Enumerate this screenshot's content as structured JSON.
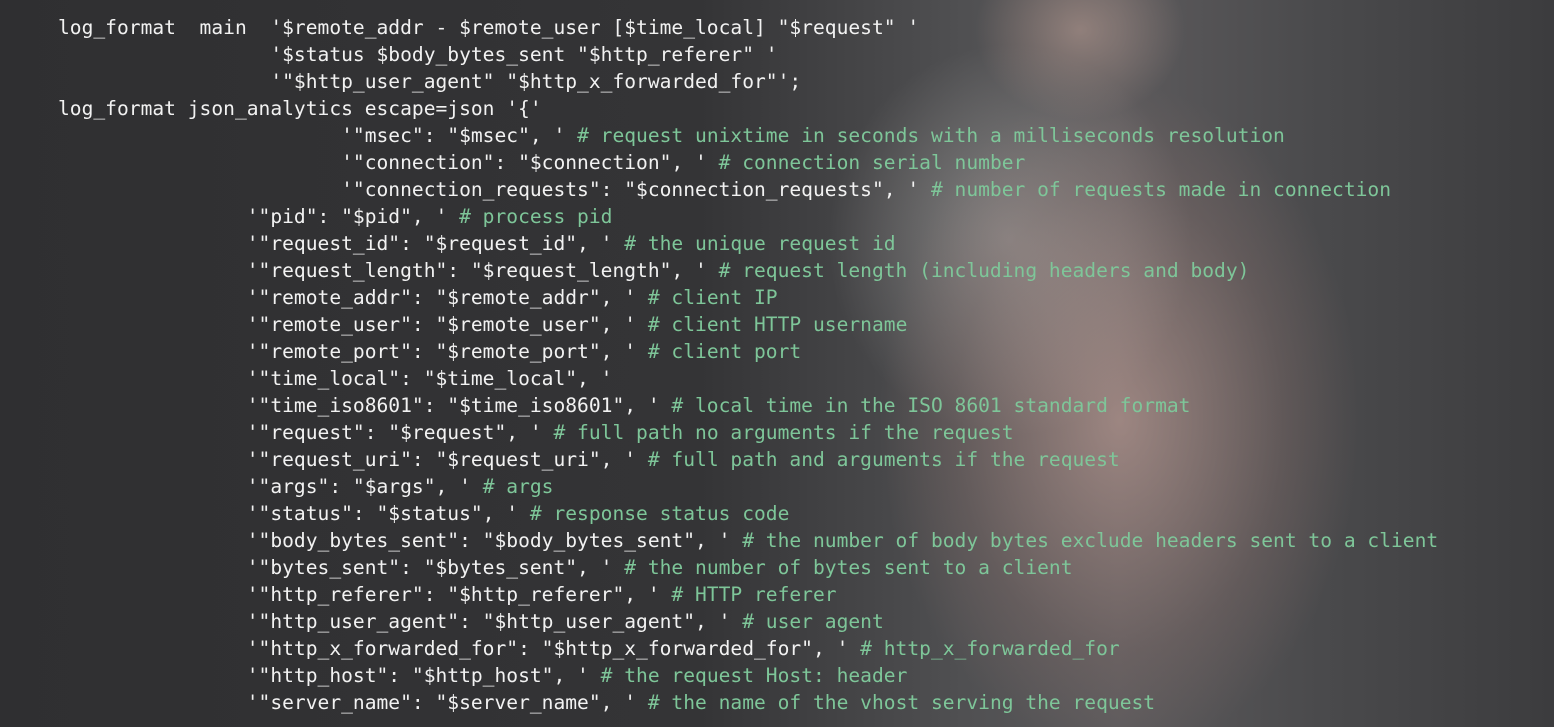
{
  "code_lines": [
    {
      "indent": 0,
      "code": "log_format  main  '$remote_addr - $remote_user [$time_local] \"$request\" '",
      "comment": ""
    },
    {
      "indent": 18,
      "code": "'$status $body_bytes_sent \"$http_referer\" '",
      "comment": ""
    },
    {
      "indent": 18,
      "code": "'\"$http_user_agent\" \"$http_x_forwarded_for\"';",
      "comment": ""
    },
    {
      "indent": 0,
      "code": "log_format json_analytics escape=json '{'",
      "comment": ""
    },
    {
      "indent": 24,
      "code": "'\"msec\": \"$msec\", ' ",
      "comment": "# request unixtime in seconds with a milliseconds resolution"
    },
    {
      "indent": 24,
      "code": "'\"connection\": \"$connection\", ' ",
      "comment": "# connection serial number"
    },
    {
      "indent": 24,
      "code": "'\"connection_requests\": \"$connection_requests\", ' ",
      "comment": "# number of requests made in connection"
    },
    {
      "indent": 16,
      "code": "'\"pid\": \"$pid\", ' ",
      "comment": "# process pid"
    },
    {
      "indent": 16,
      "code": "'\"request_id\": \"$request_id\", ' ",
      "comment": "# the unique request id"
    },
    {
      "indent": 16,
      "code": "'\"request_length\": \"$request_length\", ' ",
      "comment": "# request length (including headers and body)"
    },
    {
      "indent": 16,
      "code": "'\"remote_addr\": \"$remote_addr\", ' ",
      "comment": "# client IP"
    },
    {
      "indent": 16,
      "code": "'\"remote_user\": \"$remote_user\", ' ",
      "comment": "# client HTTP username"
    },
    {
      "indent": 16,
      "code": "'\"remote_port\": \"$remote_port\", ' ",
      "comment": "# client port"
    },
    {
      "indent": 16,
      "code": "'\"time_local\": \"$time_local\", '",
      "comment": ""
    },
    {
      "indent": 16,
      "code": "'\"time_iso8601\": \"$time_iso8601\", ' ",
      "comment": "# local time in the ISO 8601 standard format"
    },
    {
      "indent": 16,
      "code": "'\"request\": \"$request\", ' ",
      "comment": "# full path no arguments if the request"
    },
    {
      "indent": 16,
      "code": "'\"request_uri\": \"$request_uri\", ' ",
      "comment": "# full path and arguments if the request"
    },
    {
      "indent": 16,
      "code": "'\"args\": \"$args\", ' ",
      "comment": "# args"
    },
    {
      "indent": 16,
      "code": "'\"status\": \"$status\", ' ",
      "comment": "# response status code"
    },
    {
      "indent": 16,
      "code": "'\"body_bytes_sent\": \"$body_bytes_sent\", ' ",
      "comment": "# the number of body bytes exclude headers sent to a client"
    },
    {
      "indent": 16,
      "code": "'\"bytes_sent\": \"$bytes_sent\", ' ",
      "comment": "# the number of bytes sent to a client"
    },
    {
      "indent": 16,
      "code": "'\"http_referer\": \"$http_referer\", ' ",
      "comment": "# HTTP referer"
    },
    {
      "indent": 16,
      "code": "'\"http_user_agent\": \"$http_user_agent\", ' ",
      "comment": "# user agent"
    },
    {
      "indent": 16,
      "code": "'\"http_x_forwarded_for\": \"$http_x_forwarded_for\", ' ",
      "comment": "# http_x_forwarded_for"
    },
    {
      "indent": 16,
      "code": "'\"http_host\": \"$http_host\", ' ",
      "comment": "# the request Host: header"
    },
    {
      "indent": 16,
      "code": "'\"server_name\": \"$server_name\", ' ",
      "comment": "# the name of the vhost serving the request"
    }
  ]
}
